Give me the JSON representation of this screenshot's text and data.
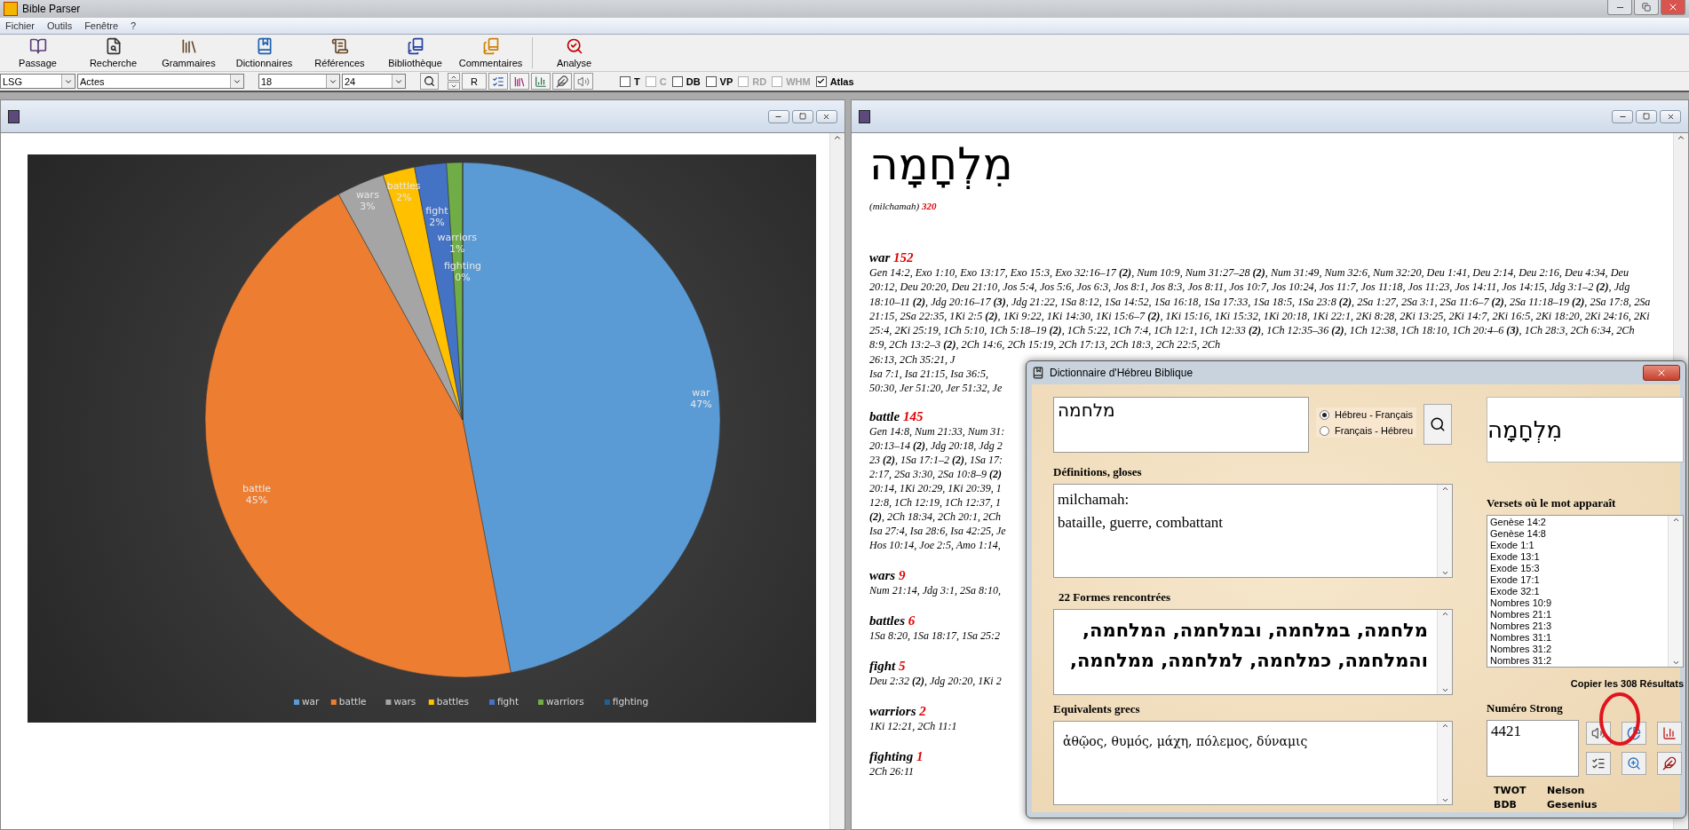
{
  "app": {
    "title": "Bible Parser"
  },
  "menu": [
    {
      "label": "Fichier"
    },
    {
      "label": "Outils"
    },
    {
      "label": "Fenêtre"
    },
    {
      "label": "?"
    }
  ],
  "toolbar": [
    {
      "label": "Passage",
      "kind": "book"
    },
    {
      "label": "Recherche",
      "kind": "search"
    },
    {
      "label": "Grammaires",
      "kind": "library"
    },
    {
      "label": "Dictionnaires",
      "kind": "dictionary"
    },
    {
      "label": "Références",
      "kind": "scroll"
    },
    {
      "label": "Bibliothèque",
      "kind": "shelf"
    },
    {
      "label": "Commentaires",
      "kind": "books"
    },
    {
      "label": "Analyse",
      "kind": "analyse"
    }
  ],
  "selectors": [
    {
      "value": "LSG"
    },
    {
      "value": "Actes"
    },
    {
      "value": "18"
    },
    {
      "value": "24"
    }
  ],
  "r_button": "R",
  "options": [
    {
      "label": "T",
      "checked": false,
      "disabled": false
    },
    {
      "label": "C",
      "checked": false,
      "disabled": true
    },
    {
      "label": "DB",
      "checked": false,
      "disabled": false
    },
    {
      "label": "VP",
      "checked": false,
      "disabled": false
    },
    {
      "label": "RD",
      "checked": false,
      "disabled": true
    },
    {
      "label": "WHM",
      "checked": false,
      "disabled": true
    },
    {
      "label": "Atlas",
      "checked": true,
      "disabled": false
    }
  ],
  "chart_window": {
    "chart_data": {
      "type": "pie",
      "categories": [
        "war",
        "battle",
        "wars",
        "battles",
        "fight",
        "warriors",
        "fighting"
      ],
      "values": [
        47,
        45,
        3,
        2,
        2,
        1,
        0
      ],
      "legend": "bottom",
      "value_labels": [
        "47%",
        "45%",
        "3%",
        "2%",
        "2%",
        "1%",
        "0%"
      ]
    }
  },
  "word_window": {
    "hebrew": "מִלְחָמָה",
    "transliteration": "(milchamah)",
    "count": "320",
    "entries": [
      {
        "word": "war",
        "count": "152",
        "text": "Gen 14:2, Exo 1:10, Exo 13:17, Exo 15:3, Exo 32:16–17 **(2)**, Num 10:9, Num 31:27–28 **(2)**, Num 31:49, Num 32:6, Num 32:20, Deu 1:41, Deu 2:14, Deu 2:16, Deu 4:34, Deu 20:12, Deu 20:20, Deu 21:10, Jos 5:4, Jos 5:6, Jos 6:3, Jos 8:1, Jos 8:3, Jos 8:11, Jos 10:7, Jos 10:24, Jos 11:7, Jos 11:18, Jos 11:23, Jos 14:11, Jos 14:15, Jdg 3:1–2 **(2)**, Jdg 18:10–11 **(2)**, Jdg 20:16–17 **(3)**, Jdg 21:22, 1Sa 8:12, 1Sa 14:52, 1Sa 16:18, 1Sa 17:33, 1Sa 18:5, 1Sa 23:8 **(2)**, 2Sa 1:27, 2Sa 3:1, 2Sa 11:6–7 **(2)**, 2Sa 11:18–19 **(2)**, 2Sa 17:8, 2Sa 21:15, 2Sa 22:35, 1Ki 2:5 **(2)**, 1Ki 9:22, 1Ki 14:30, 1Ki 15:6–7 **(2)**, 1Ki 15:16, 1Ki 15:32, 1Ki 20:18, 1Ki 22:1, 2Ki 8:28, 2Ki 13:25, 2Ki 14:7, 2Ki 16:5, 2Ki 18:20, 2Ki 24:16, 2Ki 25:4, 2Ki 25:19, 1Ch 5:10, 1Ch 5:18–19 **(2)**, 1Ch 5:22, 1Ch 7:4, 1Ch 12:1, 1Ch 12:33 **(2)**, 1Ch 12:35–36 **(2)**, 1Ch 12:38, 1Ch 18:10, 1Ch 20:4–6 **(3)**, 1Ch 28:3, 2Ch 6:34, 2Ch 8:9, 2Ch 13:2–3 **(2)**, 2Ch 14:6, 2Ch 15:19, 2Ch 17:13, 2Ch 18:3, 2Ch 22:5, 2Ch",
        "cut_lines": [
          "26:13, 2Ch 35:21, J",
          "Isa 7:1, Isa 21:15, Isa 36:5,",
          "50:30, Jer 51:20, Jer 51:32, Je"
        ]
      },
      {
        "word": "battle",
        "count": "145",
        "cut_lines": [
          "Gen 14:8, Num 21:33, Num 31:",
          "20:13–14 **(2)**, Jdg 20:18, Jdg 2",
          "23 **(2)**, 1Sa 17:1–2 **(2)**, 1Sa 17:",
          "2:17, 2Sa 3:30, 2Sa 10:8–9 **(2)**",
          "20:14, 1Ki 20:29, 1Ki 20:39, 1",
          "12:8, 1Ch 12:19, 1Ch 12:37, 1",
          "**(2)**, 2Ch 18:34, 2Ch 20:1, 2Ch",
          "Isa 27:4, Isa 28:6, Isa 42:25, Je",
          "Hos 10:14, Joe 2:5, Amo 1:14,"
        ]
      },
      {
        "word": "wars",
        "count": "9",
        "cut_lines": [
          "Num 21:14, Jdg 3:1, 2Sa 8:10,"
        ]
      },
      {
        "word": "battles",
        "count": "6",
        "cut_lines": [
          "1Sa 8:20, 1Sa 18:17, 1Sa 25:2"
        ]
      },
      {
        "word": "fight",
        "count": "5",
        "cut_lines": [
          "Deu 2:32 **(2)**, Jdg 20:20, 1Ki 2"
        ]
      },
      {
        "word": "warriors",
        "count": "2",
        "cut_lines": [
          "1Ki 12:21, 2Ch 11:1"
        ]
      },
      {
        "word": "fighting",
        "count": "1",
        "cut_lines": [
          "2Ch 26:11"
        ]
      }
    ]
  },
  "dialog": {
    "title": "Dictionnaire d'Hébreu Biblique",
    "search_value": "מלחמה",
    "directions": [
      {
        "label": "Hébreu - Français",
        "selected": true
      },
      {
        "label": "Français - Hébreu",
        "selected": false
      }
    ],
    "display_word": "מִלְחָמָה",
    "definitions_label": "Définitions, gloses",
    "definitions": [
      "milchamah:",
      "bataille, guerre, combattant"
    ],
    "forms_label": "22 Formes rencontrées",
    "forms": [
      "מלחמה, במלחמה, ובמלחמה, המלחמה,",
      "והמלחמה, כמלחמה, למלחמה, ממלחמה,"
    ],
    "greek_label": "Equivalents grecs",
    "greek": "ἀθῷος, θυμός, μάχη, πόλεμος, δύναμις",
    "verses_label": "Versets où le mot apparaît",
    "verses": [
      "Genèse 14:2",
      "Genèse 14:8",
      "Exode 1:1",
      "Exode 13:1",
      "Exode 15:3",
      "Exode 17:1",
      "Exode 32:1",
      "Nombres 10:9",
      "Nombres 21:1",
      "Nombres 21:3",
      "Nombres 31:1",
      "Nombres 31:2",
      "Nombres 31:2"
    ],
    "copy_link": "Copier les 308 Résultats",
    "strong_label": "Numéro Strong",
    "strong_value": "4421",
    "sources": [
      "TWOT",
      "Nelson",
      "BDB",
      "Gesenius"
    ]
  }
}
